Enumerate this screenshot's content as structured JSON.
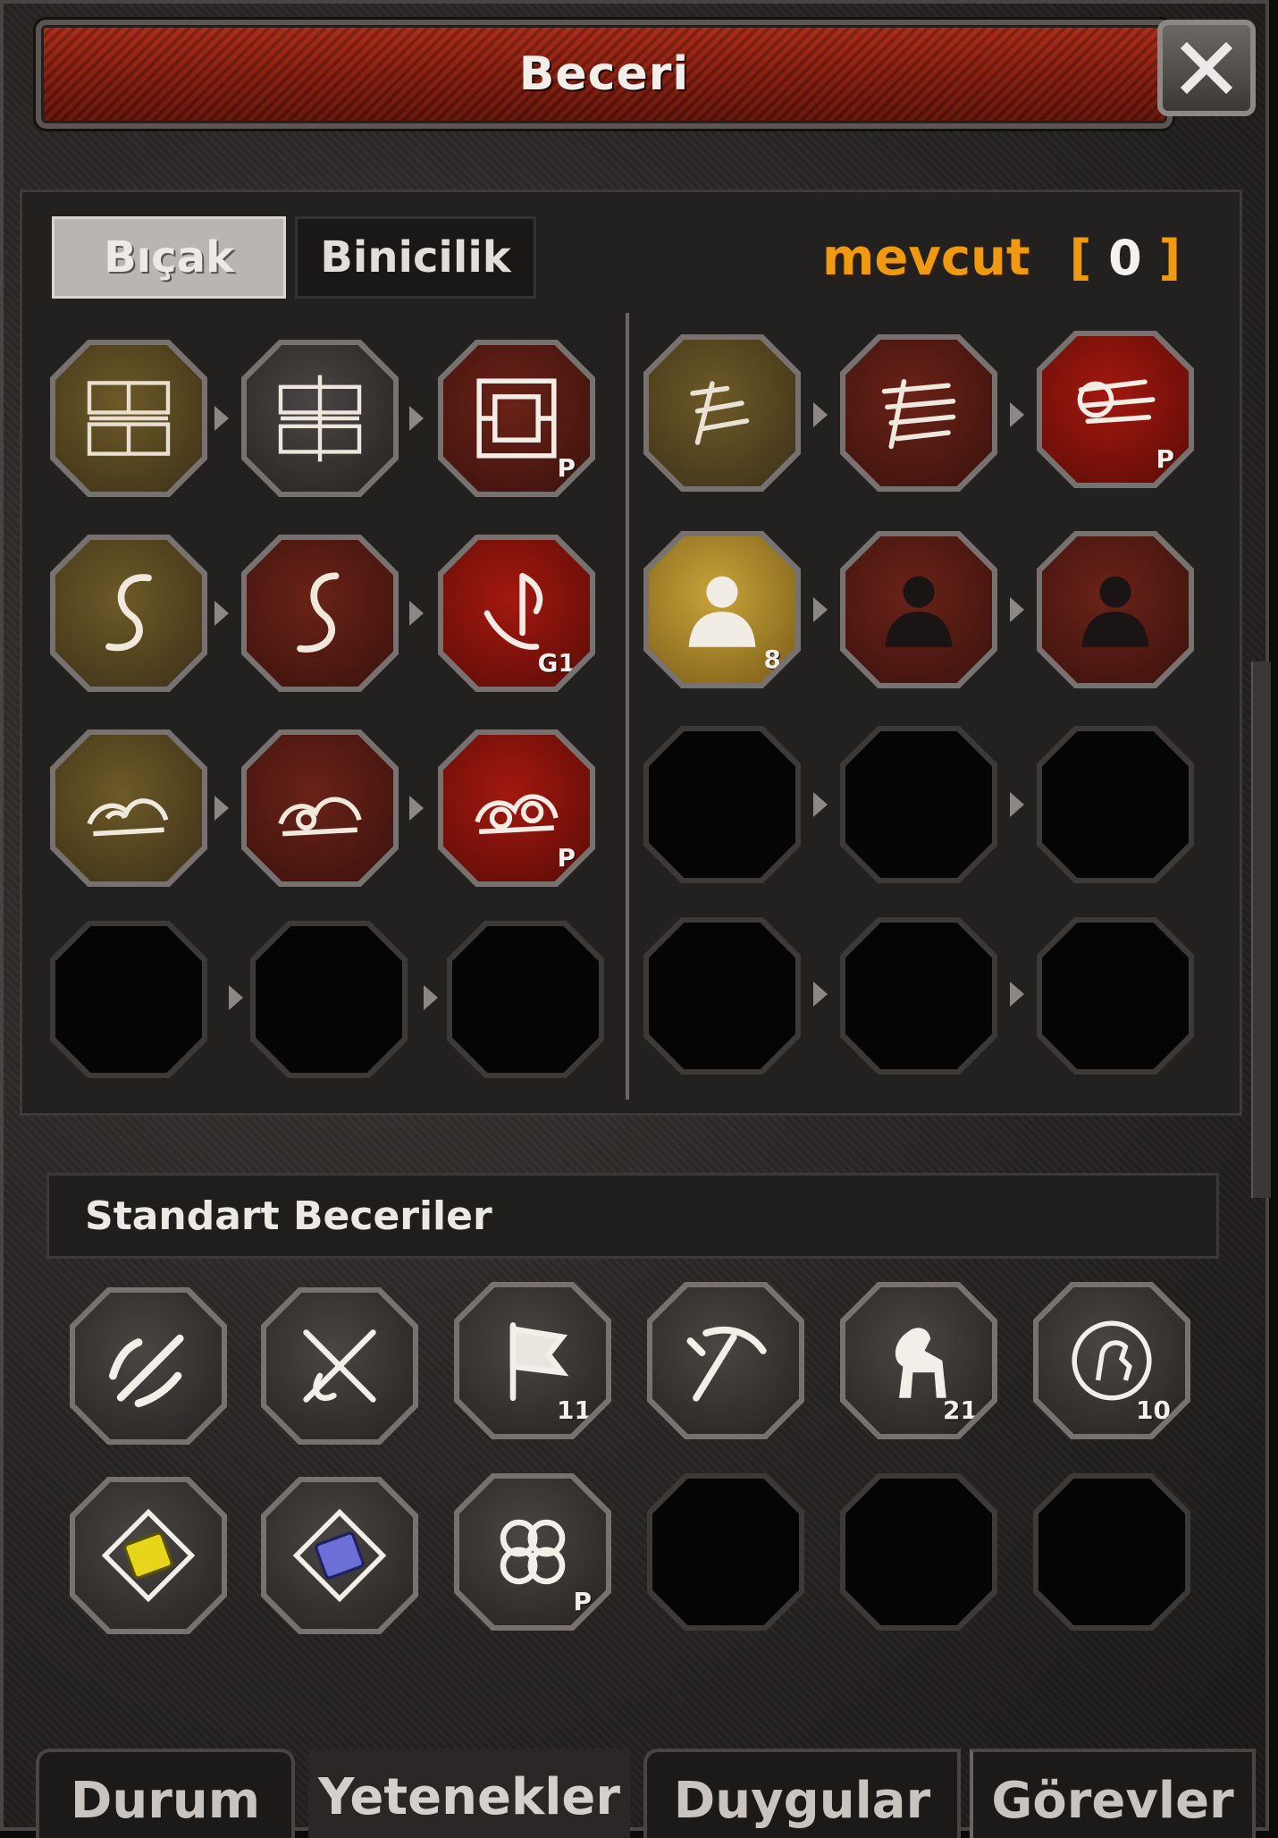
{
  "window": {
    "title": "Beceri",
    "close_label": "X"
  },
  "skill_tabs": {
    "tab1": "Bıçak",
    "tab2": "Binicilik"
  },
  "points": {
    "label": "mevcut",
    "value": "0"
  },
  "skill_slots": {
    "r0c0": {
      "badge": ""
    },
    "r0c1": {
      "badge": ""
    },
    "r0c2": {
      "badge": "P"
    },
    "r0c3": {
      "badge": ""
    },
    "r0c4": {
      "badge": ""
    },
    "r0c5": {
      "badge": "P"
    },
    "r1c0": {
      "badge": ""
    },
    "r1c1": {
      "badge": ""
    },
    "r1c2": {
      "badge": "G1"
    },
    "r1c3": {
      "badge": "8"
    },
    "r1c4": {
      "badge": ""
    },
    "r1c5": {
      "badge": ""
    },
    "r2c0": {
      "badge": ""
    },
    "r2c1": {
      "badge": ""
    },
    "r2c2": {
      "badge": "P"
    }
  },
  "standard_section": {
    "label": "Standart Beceriler"
  },
  "standard_slots": {
    "s0": {
      "badge": ""
    },
    "s1": {
      "badge": ""
    },
    "s2": {
      "badge": "11"
    },
    "s3": {
      "badge": ""
    },
    "s4": {
      "badge": "21"
    },
    "s5": {
      "badge": "10"
    },
    "s6": {
      "badge": ""
    },
    "s7": {
      "badge": ""
    },
    "s8": {
      "badge": "P"
    }
  },
  "bottom_tabs": {
    "status": "Durum",
    "skills": "Yetenekler",
    "emotions": "Duygular",
    "quests": "Görevler"
  }
}
